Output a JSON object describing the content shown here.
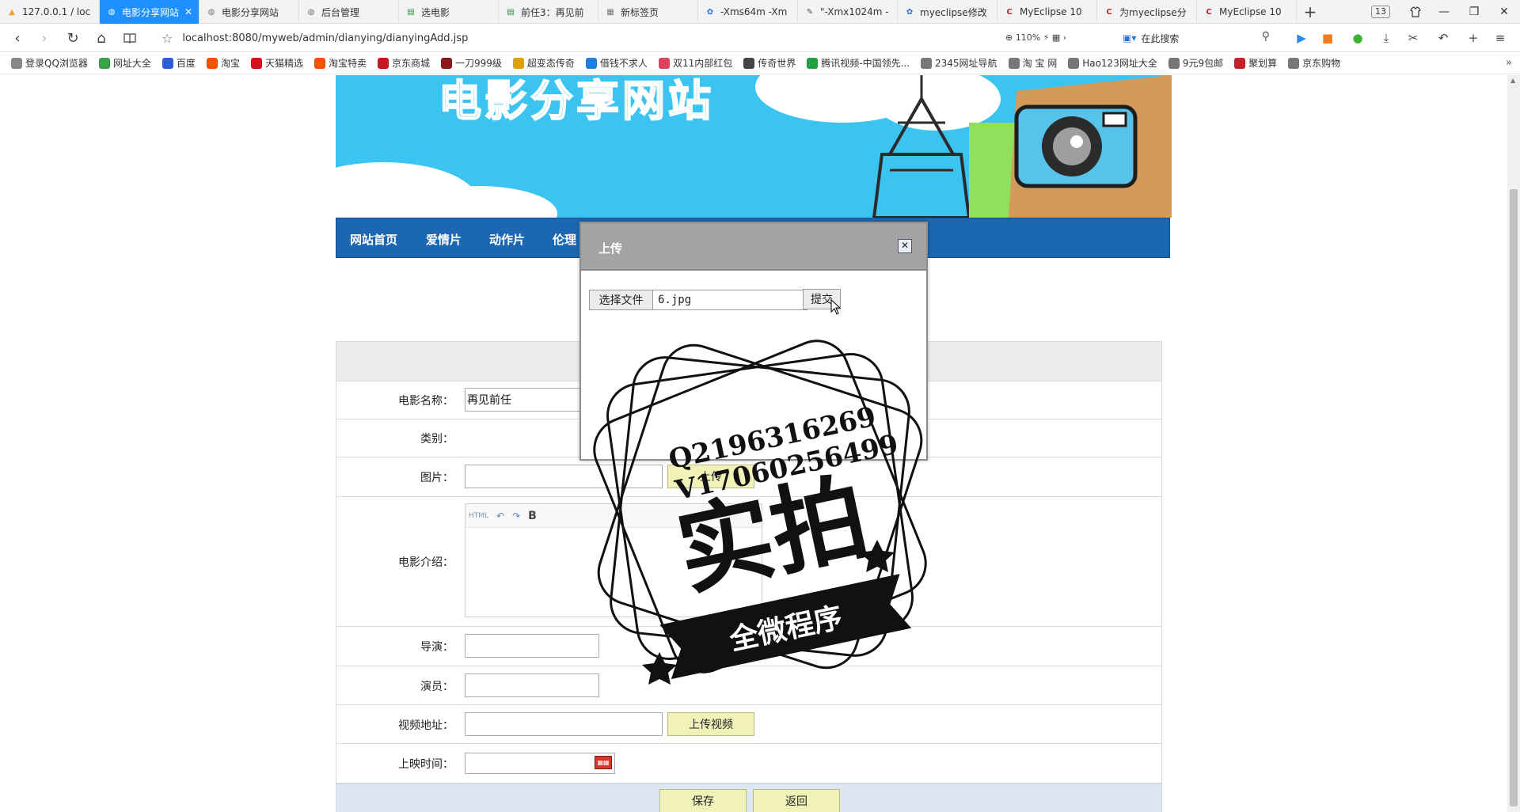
{
  "browser": {
    "tabs": [
      {
        "label": "127.0.0.1 / loc",
        "icon": "pma-icon",
        "color": "#f0a030"
      },
      {
        "label": "电影分享网站",
        "icon": "globe-icon",
        "color": "#ffffff",
        "active": true
      },
      {
        "label": "电影分享网站",
        "icon": "globe-icon",
        "color": "#777777"
      },
      {
        "label": "后台管理",
        "icon": "globe-icon",
        "color": "#777777"
      },
      {
        "label": "选电影",
        "icon": "sheet-icon",
        "color": "#2f8f3f"
      },
      {
        "label": "前任3：再见前",
        "icon": "sheet-icon",
        "color": "#2f8f3f"
      },
      {
        "label": "新标签页",
        "icon": "grid-icon",
        "color": "#777777"
      },
      {
        "label": "-Xms64m -Xm",
        "icon": "paw-icon",
        "color": "#2b6fd8"
      },
      {
        "label": "\"-Xmx1024m -",
        "icon": "feather-icon",
        "color": "#555555"
      },
      {
        "label": "myeclipse修改",
        "icon": "paw-icon",
        "color": "#2b6fd8"
      },
      {
        "label": "MyEclipse 10",
        "icon": "c-icon",
        "color": "#c8202b"
      },
      {
        "label": "为myeclipse分",
        "icon": "c-icon",
        "color": "#c8202b"
      },
      {
        "label": "MyEclipse 10",
        "icon": "c-icon",
        "color": "#c8202b"
      }
    ],
    "tab_count": "13",
    "url": "localhost:8080/myweb/admin/dianying/dianyingAdd.jsp",
    "zoom": "110%",
    "search_placeholder": "在此搜索",
    "bookmarks": [
      {
        "label": "登录QQ浏览器",
        "color": "#888888"
      },
      {
        "label": "网址大全",
        "color": "#3aa14a"
      },
      {
        "label": "百度",
        "color": "#2f5fd8"
      },
      {
        "label": "淘宝",
        "color": "#f55000"
      },
      {
        "label": "天猫精选",
        "color": "#d8101e"
      },
      {
        "label": "淘宝特卖",
        "color": "#f55000"
      },
      {
        "label": "京东商城",
        "color": "#c81623"
      },
      {
        "label": "一刀999级",
        "color": "#8a1a1a"
      },
      {
        "label": "超变态传奇",
        "color": "#e0a000"
      },
      {
        "label": "借钱不求人",
        "color": "#2080e0"
      },
      {
        "label": "双11内部红包",
        "color": "#e04060"
      },
      {
        "label": "传奇世界",
        "color": "#444444"
      },
      {
        "label": "腾讯视频-中国领先...",
        "color": "#20a040"
      },
      {
        "label": "2345网址导航",
        "color": "#777777"
      },
      {
        "label": "淘 宝 网",
        "color": "#777777"
      },
      {
        "label": "Hao123网址大全",
        "color": "#777777"
      },
      {
        "label": "9元9包邮",
        "color": "#777777"
      },
      {
        "label": "聚划算",
        "color": "#c8202b"
      },
      {
        "label": "京东购物",
        "color": "#777777"
      }
    ]
  },
  "site": {
    "title": "电影分享网站",
    "menu": [
      "网站首页",
      "爱情片",
      "动作片",
      "伦理"
    ]
  },
  "form": {
    "fields": {
      "name_label": "电影名称：",
      "name_value": "再见前任",
      "category_label": "类别：",
      "image_label": "图片：",
      "image_upload_btn": "上传",
      "intro_label": "电影介绍：",
      "director_label": "导演：",
      "actor_label": "演员：",
      "video_label": "视频地址：",
      "video_upload_btn": "上传视频",
      "release_label": "上映时间："
    },
    "save_btn": "保存",
    "back_btn": "返回",
    "editor_toolbar": [
      "HTML",
      "undo-icon",
      "redo-icon",
      "B"
    ]
  },
  "dialog": {
    "title": "上传",
    "choose_btn": "选择文件",
    "file_name": "6.jpg",
    "submit_btn": "提交",
    "close": "✕"
  },
  "watermark": {
    "line1": "Q2196316269",
    "line2": "V17060256499",
    "big": "实拍",
    "ribbon": "全微程序"
  }
}
